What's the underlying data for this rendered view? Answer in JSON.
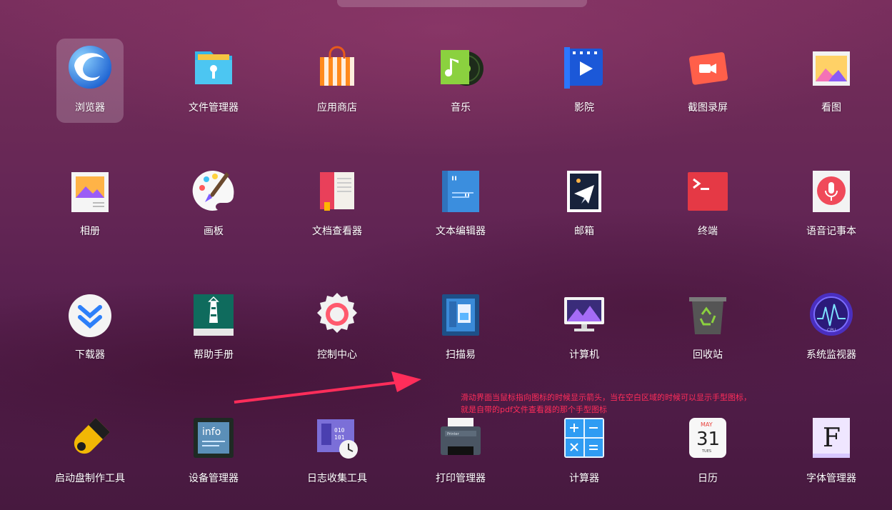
{
  "apps": [
    {
      "label": "浏览器",
      "icon": "browser-icon",
      "active": true
    },
    {
      "label": "文件管理器",
      "icon": "file-manager-icon"
    },
    {
      "label": "应用商店",
      "icon": "app-store-icon"
    },
    {
      "label": "音乐",
      "icon": "music-icon"
    },
    {
      "label": "影院",
      "icon": "movie-icon"
    },
    {
      "label": "截图录屏",
      "icon": "screenshot-recorder-icon"
    },
    {
      "label": "看图",
      "icon": "image-viewer-icon"
    },
    {
      "label": "相册",
      "icon": "album-icon"
    },
    {
      "label": "画板",
      "icon": "draw-icon"
    },
    {
      "label": "文档查看器",
      "icon": "document-viewer-icon"
    },
    {
      "label": "文本编辑器",
      "icon": "text-editor-icon"
    },
    {
      "label": "邮箱",
      "icon": "mail-icon"
    },
    {
      "label": "终端",
      "icon": "terminal-icon"
    },
    {
      "label": "语音记事本",
      "icon": "voice-note-icon"
    },
    {
      "label": "下载器",
      "icon": "downloader-icon"
    },
    {
      "label": "帮助手册",
      "icon": "manual-icon"
    },
    {
      "label": "控制中心",
      "icon": "control-center-icon"
    },
    {
      "label": "扫描易",
      "icon": "scanner-icon"
    },
    {
      "label": "计算机",
      "icon": "computer-icon"
    },
    {
      "label": "回收站",
      "icon": "trash-icon"
    },
    {
      "label": "系统监视器",
      "icon": "system-monitor-icon"
    },
    {
      "label": "启动盘制作工具",
      "icon": "boot-maker-icon"
    },
    {
      "label": "设备管理器",
      "icon": "device-manager-icon"
    },
    {
      "label": "日志收集工具",
      "icon": "log-viewer-icon"
    },
    {
      "label": "打印管理器",
      "icon": "print-manager-icon"
    },
    {
      "label": "计算器",
      "icon": "calculator-icon"
    },
    {
      "label": "日历",
      "icon": "calendar-icon"
    },
    {
      "label": "字体管理器",
      "icon": "font-manager-icon"
    }
  ],
  "annotation": {
    "line1": "滑动界面当鼠标指向图标的时候显示箭头，当在空白区域的时候可以显示手型图标，",
    "line2": "就是自带的pdf文件查看器的那个手型图标"
  },
  "calendar": {
    "month": "MAY",
    "day": "31",
    "weekday": "TUES"
  },
  "info_badge": "info",
  "font_letter": "F",
  "printer_text": "Printer",
  "colors": {
    "annotation": "#ff2d5a",
    "active_tile": "rgba(255,255,255,0.2)"
  }
}
